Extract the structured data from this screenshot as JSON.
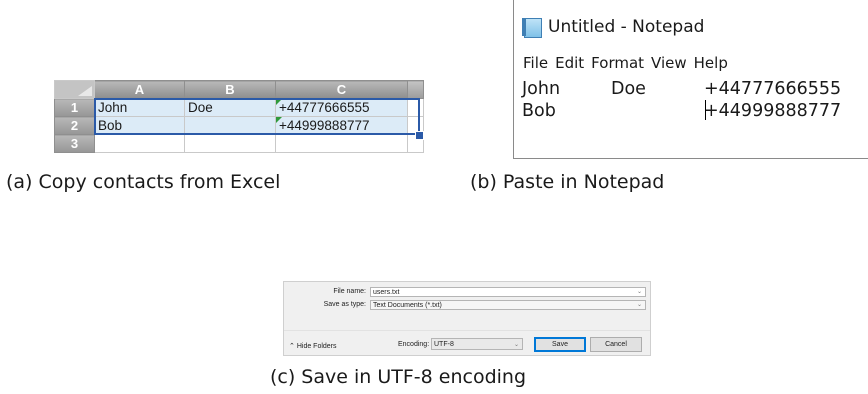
{
  "excel": {
    "columns": [
      "A",
      "B",
      "C"
    ],
    "rows": [
      {
        "num": "1",
        "cells": [
          "John",
          "Doe",
          "+44777666555"
        ]
      },
      {
        "num": "2",
        "cells": [
          "Bob",
          "",
          "+44999888777"
        ]
      },
      {
        "num": "3",
        "cells": [
          "",
          "",
          ""
        ]
      }
    ],
    "selection_color": "#2b5aa8",
    "selected_fill": "#dcebf7"
  },
  "captions": {
    "a": "(a) Copy contacts from Excel",
    "b": "(b) Paste in Notepad",
    "c": "(c) Save in UTF-8 encoding"
  },
  "notepad": {
    "title": "Untitled - Notepad",
    "icon": "notepad-icon",
    "menu": [
      "File",
      "Edit",
      "Format",
      "View",
      "Help"
    ],
    "lines": [
      [
        "John",
        "Doe",
        "+44777666555"
      ],
      [
        "Bob",
        "",
        "+44999888777"
      ]
    ]
  },
  "save_dialog": {
    "file_name_label": "File name:",
    "file_name_value": "users.txt",
    "save_as_type_label": "Save as type:",
    "save_as_type_value": "Text Documents (*.txt)",
    "hide_folders": "Hide Folders",
    "encoding_label": "Encoding:",
    "encoding_value": "UTF-8",
    "save_button": "Save",
    "cancel_button": "Cancel",
    "accent": "#0078d7"
  }
}
